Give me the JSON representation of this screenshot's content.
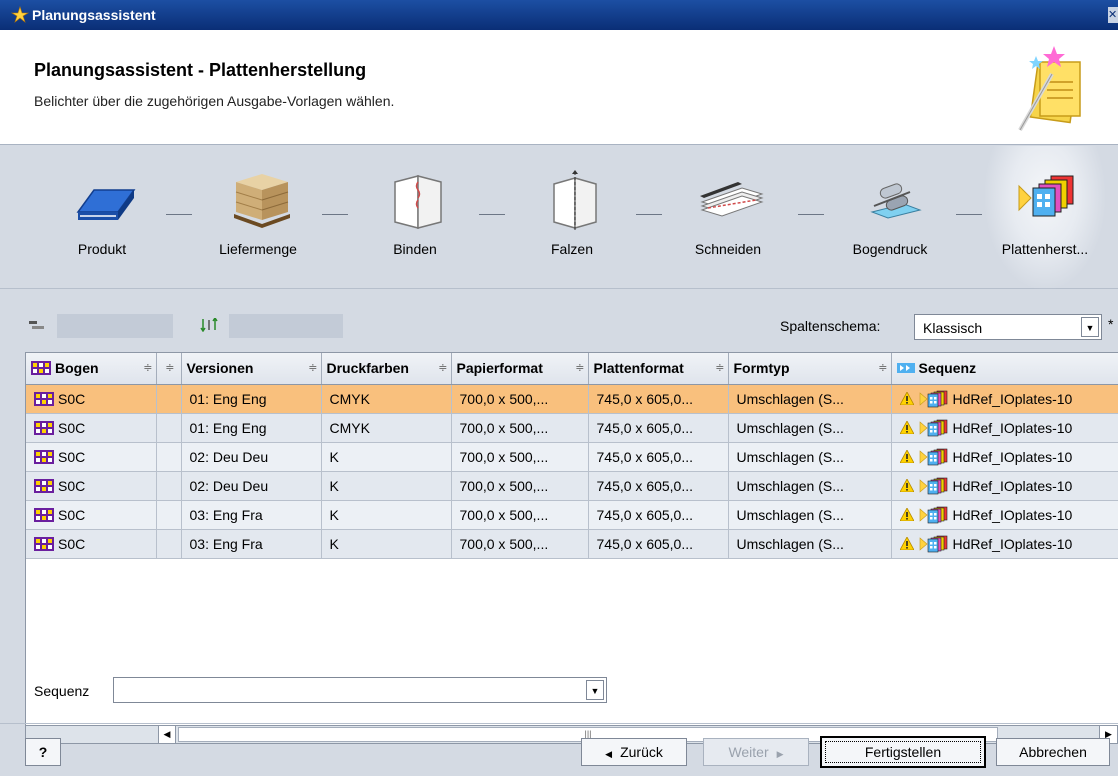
{
  "window": {
    "title": "Planungsassistent"
  },
  "header": {
    "title": "Planungsassistent - Plattenherstellung",
    "subtitle": "Belichter über die zugehörigen Ausgabe-Vorlagen wählen."
  },
  "steps": [
    {
      "label": "Produkt",
      "icon": "book-icon"
    },
    {
      "label": "Liefermenge",
      "icon": "pallet-icon"
    },
    {
      "label": "Binden",
      "icon": "binding-icon"
    },
    {
      "label": "Falzen",
      "icon": "fold-icon"
    },
    {
      "label": "Schneiden",
      "icon": "cut-icon"
    },
    {
      "label": "Bogendruck",
      "icon": "press-icon"
    },
    {
      "label": "Plattenherst...",
      "icon": "plates-icon"
    }
  ],
  "toolbar": {
    "schema_label": "Spaltenschema:",
    "schema_value": "Klassisch",
    "asterisk": "*"
  },
  "table": {
    "columns": [
      "Bogen",
      "",
      "Versionen",
      "Druckfarben",
      "Papierformat",
      "Plattenformat",
      "Formtyp",
      "Sequenz"
    ],
    "rows": [
      {
        "bogen": "S0C",
        "versionen": "01: Eng Eng",
        "druckfarben": "CMYK",
        "papierformat": "700,0 x 500,...",
        "plattenformat": "745,0 x 605,0...",
        "formtyp": "Umschlagen (S...",
        "sequenz": "HdRef_IOplates-10",
        "selected": true
      },
      {
        "bogen": "S0C",
        "versionen": "01: Eng Eng",
        "druckfarben": "CMYK",
        "papierformat": "700,0 x 500,...",
        "plattenformat": "745,0 x 605,0...",
        "formtyp": "Umschlagen (S...",
        "sequenz": "HdRef_IOplates-10",
        "selected": false
      },
      {
        "bogen": "S0C",
        "versionen": "02: Deu Deu",
        "druckfarben": "K",
        "papierformat": "700,0 x 500,...",
        "plattenformat": "745,0 x 605,0...",
        "formtyp": "Umschlagen (S...",
        "sequenz": "HdRef_IOplates-10",
        "selected": false
      },
      {
        "bogen": "S0C",
        "versionen": "02: Deu Deu",
        "druckfarben": "K",
        "papierformat": "700,0 x 500,...",
        "plattenformat": "745,0 x 605,0...",
        "formtyp": "Umschlagen (S...",
        "sequenz": "HdRef_IOplates-10",
        "selected": false
      },
      {
        "bogen": "S0C",
        "versionen": "03: Eng Fra",
        "druckfarben": "K",
        "papierformat": "700,0 x 500,...",
        "plattenformat": "745,0 x 605,0...",
        "formtyp": "Umschlagen (S...",
        "sequenz": "HdRef_IOplates-10",
        "selected": false
      },
      {
        "bogen": "S0C",
        "versionen": "03: Eng Fra",
        "druckfarben": "K",
        "papierformat": "700,0 x 500,...",
        "plattenformat": "745,0 x 605,0...",
        "formtyp": "Umschlagen (S...",
        "sequenz": "HdRef_IOplates-10",
        "selected": false
      }
    ]
  },
  "sequenz": {
    "label": "Sequenz",
    "value": ""
  },
  "buttons": {
    "help": "?",
    "back": "Zurück",
    "next": "Weiter",
    "finish": "Fertigstellen",
    "cancel": "Abbrechen"
  },
  "colors": {
    "selected_row": "#f9c07d",
    "titlebar": "#0a2e76",
    "background": "#d4dae3"
  }
}
